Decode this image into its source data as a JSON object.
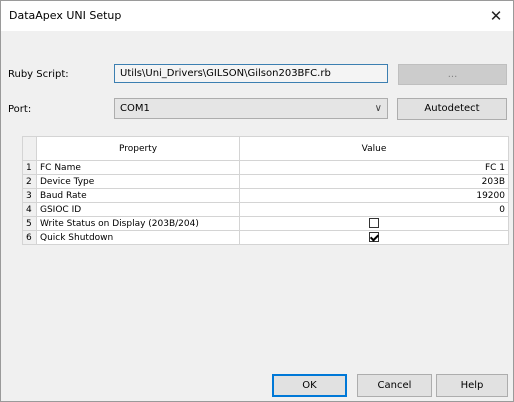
{
  "window": {
    "title": "DataApex UNI Setup",
    "close_glyph": "✕"
  },
  "script": {
    "label": "Ruby Script:",
    "value": "Utils\\Uni_Drivers\\GILSON\\Gilson203BFC.rb",
    "browse_label": "..."
  },
  "port": {
    "label": "Port:",
    "selected": "COM1",
    "chevron": "∨",
    "autodetect_label": "Autodetect"
  },
  "grid": {
    "headers": {
      "property": "Property",
      "value": "Value"
    },
    "rows": [
      {
        "num": "1",
        "property": "FC Name",
        "value": "FC 1"
      },
      {
        "num": "2",
        "property": "Device Type",
        "value": "203B"
      },
      {
        "num": "3",
        "property": "Baud Rate",
        "value": "19200"
      },
      {
        "num": "4",
        "property": "GSIOC ID",
        "value": "0"
      },
      {
        "num": "5",
        "property": "Write Status on Display (203B/204)",
        "checked": false
      },
      {
        "num": "6",
        "property": "Quick Shutdown",
        "checked": true
      }
    ]
  },
  "footer": {
    "ok_label": "OK",
    "cancel_label": "Cancel",
    "help_label": "Help"
  },
  "colors": {
    "accent": "#0078d7",
    "field_border": "#3c7fb1",
    "dialog_bg": "#f0f0f0"
  }
}
